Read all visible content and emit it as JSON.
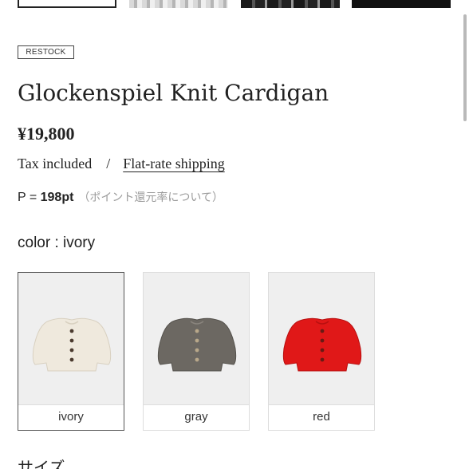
{
  "badge": "RESTOCK",
  "product": {
    "title": "Glockenspiel Knit Cardigan",
    "price": "¥19,800",
    "tax_note": "Tax included",
    "separator": "/",
    "shipping_link": "Flat-rate shipping"
  },
  "points": {
    "prefix": "P = ",
    "value": "198pt",
    "link": "（ポイント還元率について）"
  },
  "color": {
    "label": "color : ivory",
    "options": [
      {
        "name": "ivory",
        "selected": true,
        "swatch_color": "#efe9dd",
        "button_color": "#4a3a2e"
      },
      {
        "name": "gray",
        "selected": false,
        "swatch_color": "#6c6862",
        "button_color": "#b9a88a"
      },
      {
        "name": "red",
        "selected": false,
        "swatch_color": "#e01818",
        "button_color": "#6a1a14"
      }
    ]
  },
  "size": {
    "label": "サイズ"
  },
  "colors": {
    "text": "#222222",
    "muted": "#9a9a9a",
    "border": "#dddddd",
    "image_bg": "#efefef"
  }
}
